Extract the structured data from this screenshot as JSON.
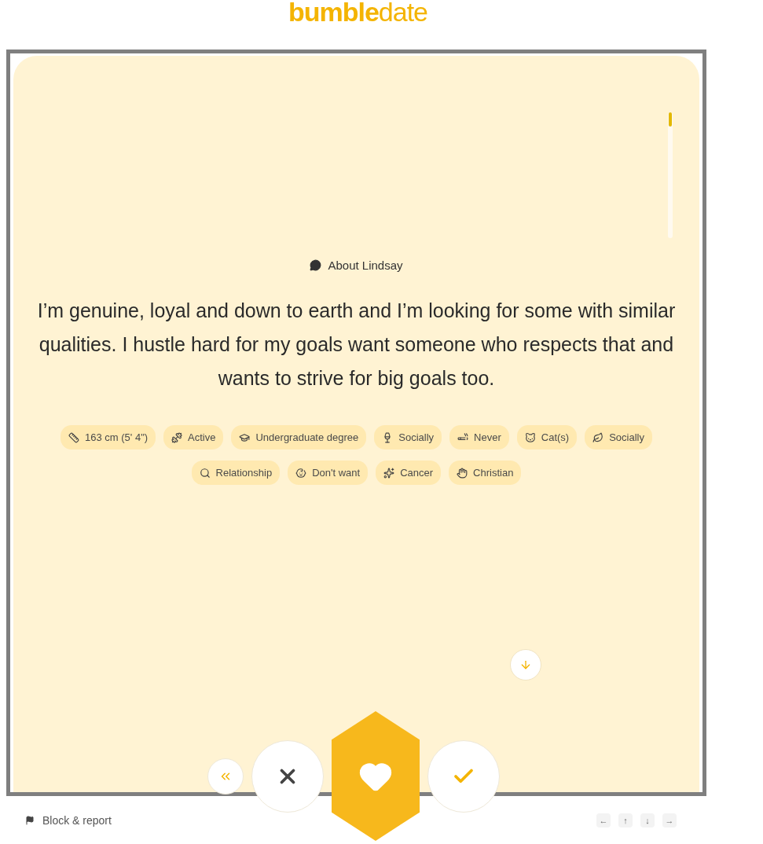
{
  "logo": {
    "brand": "bumble",
    "product": "date"
  },
  "about": {
    "title": "About Lindsay",
    "bio": "I’m genuine, loyal and down to earth and I’m looking for some with similar qualities. I hustle hard for my goals want someone who respects that and wants to strive for big goals too."
  },
  "tags": [
    {
      "kind": "height",
      "label": "163 cm (5' 4\")"
    },
    {
      "kind": "exercise",
      "label": "Active"
    },
    {
      "kind": "education",
      "label": "Undergraduate degree"
    },
    {
      "kind": "drinking",
      "label": "Socially"
    },
    {
      "kind": "smoking",
      "label": "Never"
    },
    {
      "kind": "pets",
      "label": "Cat(s)"
    },
    {
      "kind": "cannabis",
      "label": "Socially"
    },
    {
      "kind": "looking_for",
      "label": "Relationship"
    },
    {
      "kind": "kids",
      "label": "Don't want"
    },
    {
      "kind": "zodiac",
      "label": "Cancer"
    },
    {
      "kind": "religion",
      "label": "Christian"
    }
  ],
  "actions": [
    {
      "kind": "rewind"
    },
    {
      "kind": "pass"
    },
    {
      "kind": "superswipe"
    },
    {
      "kind": "like"
    }
  ],
  "footer": {
    "report": "Block & report",
    "keys": [
      "←",
      "↑",
      "↓",
      "→"
    ]
  }
}
